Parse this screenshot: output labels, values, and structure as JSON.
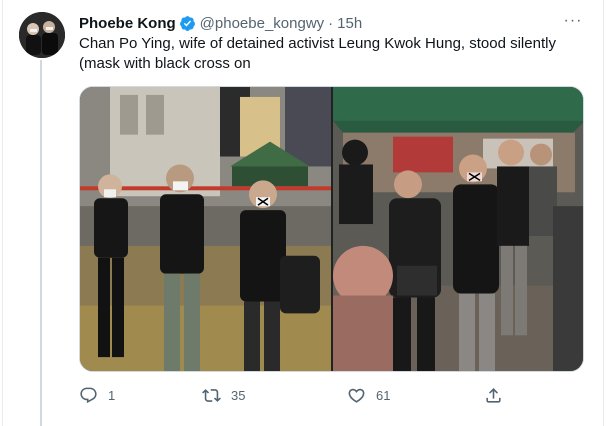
{
  "tweet": {
    "display_name": "Phoebe Kong",
    "handle": "@phoebe_kongwy",
    "separator": "·",
    "time": "15h",
    "text": "Chan Po Ying, wife of detained activist Leung Kwok Hung, stood silently (mask with black cross on",
    "verified": true,
    "more_label": "···"
  },
  "media": {
    "photo_count": 2,
    "photos": [
      {
        "icon": "photo-protesters-standing"
      },
      {
        "icon": "photo-police-tent"
      }
    ]
  },
  "actions": {
    "reply": {
      "count": "1",
      "icon": "reply-icon"
    },
    "retweet": {
      "count": "35",
      "icon": "retweet-icon"
    },
    "like": {
      "count": "61",
      "icon": "heart-icon"
    },
    "share": {
      "count": "",
      "icon": "share-icon"
    }
  },
  "colors": {
    "text": "#0f1419",
    "secondary": "#536471",
    "verified": "#1d9bf0",
    "border": "#cfd9de"
  }
}
